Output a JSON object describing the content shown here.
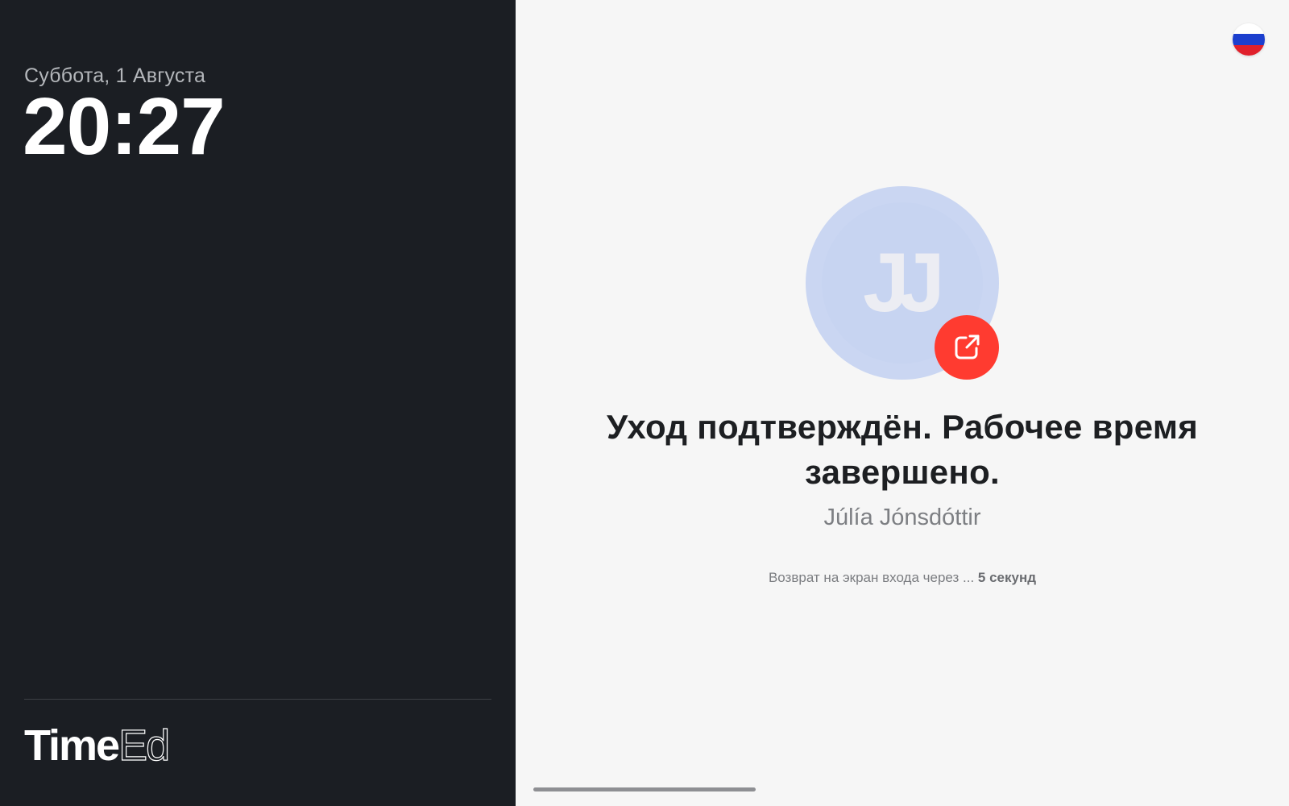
{
  "left_panel": {
    "date": "Суббота, 1 Августа",
    "time": "20:27",
    "logo": {
      "bold": "Time",
      "thin": "Ed"
    }
  },
  "right_panel": {
    "language_flag": {
      "icon": "russia-flag-icon",
      "colors": [
        "#ffffff",
        "#1c3fce",
        "#e0202b"
      ]
    },
    "avatar": {
      "initials": "JJ",
      "background": "#cad6f2",
      "badge_icon": "external-link-icon",
      "badge_color": "#ff3b30"
    },
    "headline": "Уход подтверждён. Рабочее время завершено.",
    "user_name": "Júlía Jónsdóttir",
    "countdown": {
      "prefix": "Возврат на экран входа через ...",
      "value": "5 секунд"
    }
  }
}
